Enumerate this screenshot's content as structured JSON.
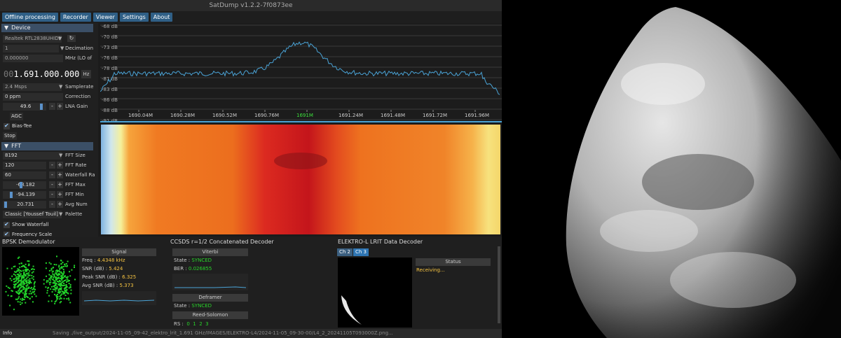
{
  "window": {
    "title": "SatDump v1.2.2-7f0873ee"
  },
  "menu": [
    "Offline processing",
    "Recorder",
    "Viewer",
    "Settings",
    "About"
  ],
  "device": {
    "header": "Device",
    "sdr_name": "Realtek RTL2838UHIDI",
    "index": "1",
    "decimation_label": "Decimation",
    "lo_value": "0.000000",
    "lo_label": "MHz (LO of",
    "freq_dim": "00",
    "freq_main": "1.691.000.000",
    "freq_unit": "Hz",
    "samplerate": "2.4 Msps",
    "samplerate_label": "Samplerate",
    "ppm": "0 ppm",
    "correction_label": "Correction",
    "lna_value": "49.6",
    "lna_label": "LNA Gain",
    "agc_label": "AGC",
    "biastee_label": "Bias-Tee",
    "stop_label": "Stop"
  },
  "fft": {
    "header": "FFT",
    "size": "8192",
    "size_label": "FFT Size",
    "rate": "120",
    "rate_label": "FFT Rate",
    "wf_rate": "60",
    "wf_rate_label": "Waterfall Ra",
    "max": "-68.182",
    "max_label": "FFT Max",
    "min": "-94.139",
    "min_label": "FFT Min",
    "avg": "20.731",
    "avg_label": "Avg Num",
    "palette": "Classic [Youssef Touil]",
    "palette_label": "Palette",
    "show_wf_label": "Show Waterfall",
    "freq_scale_label": "Frequency Scale"
  },
  "spectrum": {
    "db_labels": [
      "-68 dB",
      "-70 dB",
      "-73 dB",
      "-76 dB",
      "-78 dB",
      "-81 dB",
      "-83 dB",
      "-86 dB",
      "-88 dB",
      "-91 dB"
    ],
    "freq_labels": [
      "1690.04M",
      "1690.28M",
      "1690.52M",
      "1690.76M",
      "1691M",
      "1691.24M",
      "1691.48M",
      "1691.72M",
      "1691.96M"
    ],
    "line_color": "#4aa3d6",
    "center_label_color": "#3ce03c"
  },
  "bpsk": {
    "title": "BPSK Demodulator",
    "signal_hdr": "Signal",
    "freq_label": "Freq :",
    "freq_value": "4.4348 kHz",
    "snr_label": "SNR (dB) :",
    "snr_value": "5.424",
    "peak_label": "Peak SNR (dB) :",
    "peak_value": "6.325",
    "avg_label": "Avg SNR (dB) :",
    "avg_value": "5.373"
  },
  "ccsds": {
    "title": "CCSDS r=1/2 Concatenated Decoder",
    "viterbi_hdr": "Viterbi",
    "state_label": "State :",
    "viterbi_state": "SYNCED",
    "ber_label": "BER :",
    "ber_value": "0.026855",
    "deframer_hdr": "Deframer",
    "deframer_state": "SYNCED",
    "rs_hdr": "Reed-Solomon",
    "rs_label": "RS :",
    "rs_values": [
      "0",
      "1",
      "2",
      "3"
    ]
  },
  "lrit": {
    "title": "ELEKTRO-L LRIT Data Decoder",
    "tabs": [
      "Ch 2",
      "Ch 3"
    ],
    "status_hdr": "Status",
    "status_value": "Receiving..."
  },
  "status": {
    "info_label": "Info",
    "message": "Saving ./live_output/2024-11-05_09-42_elektro_lrit_1.691 GHz/IMAGES/ELEKTRO-L4/2024-11-05_09-30-00/L4_2_20241105T093000Z.png..."
  }
}
